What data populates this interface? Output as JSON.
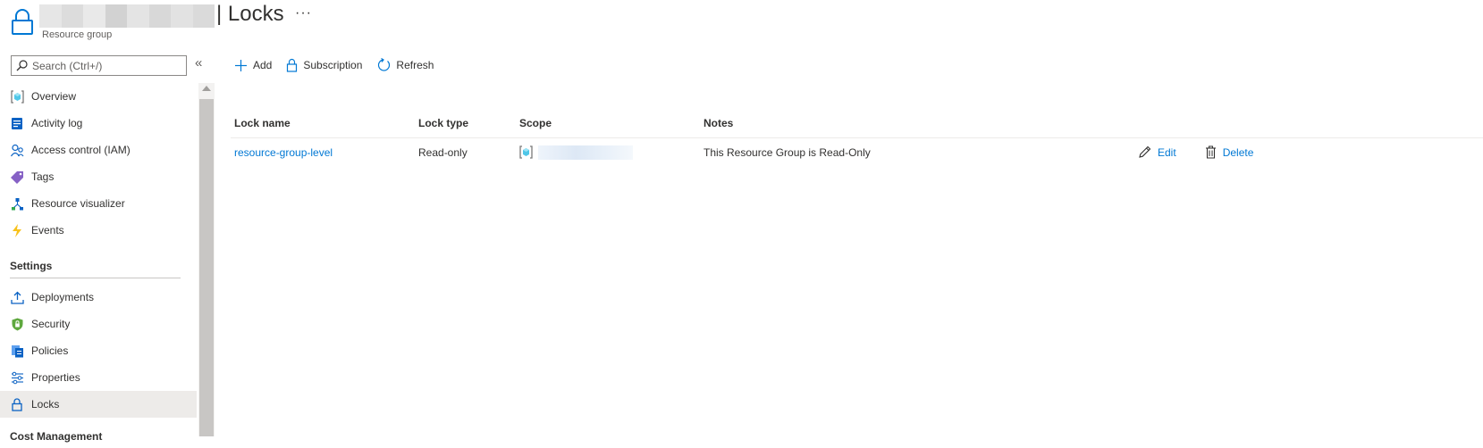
{
  "header": {
    "title": "| Locks",
    "subtitle": "Resource group",
    "more": "···"
  },
  "sidebar": {
    "search_placeholder": "Search (Ctrl+/)",
    "collapse": "«",
    "items": [
      {
        "label": "Overview",
        "icon": "resource-group-icon"
      },
      {
        "label": "Activity log",
        "icon": "activity-log-icon"
      },
      {
        "label": "Access control (IAM)",
        "icon": "people-icon"
      },
      {
        "label": "Tags",
        "icon": "tag-icon"
      },
      {
        "label": "Resource visualizer",
        "icon": "visualizer-icon"
      },
      {
        "label": "Events",
        "icon": "lightning-icon"
      }
    ],
    "settings_header": "Settings",
    "settings_items": [
      {
        "label": "Deployments",
        "icon": "upload-icon"
      },
      {
        "label": "Security",
        "icon": "shield-icon"
      },
      {
        "label": "Policies",
        "icon": "policy-icon"
      },
      {
        "label": "Properties",
        "icon": "sliders-icon"
      },
      {
        "label": "Locks",
        "icon": "lock-icon",
        "active": true
      }
    ],
    "cost_header": "Cost Management"
  },
  "toolbar": {
    "add": "Add",
    "subscription": "Subscription",
    "refresh": "Refresh"
  },
  "table": {
    "columns": [
      "Lock name",
      "Lock type",
      "Scope",
      "Notes"
    ],
    "rows": [
      {
        "name": "resource-group-level",
        "type": "Read-only",
        "notes": "This Resource Group is Read-Only",
        "edit": "Edit",
        "delete": "Delete"
      }
    ]
  },
  "colors": {
    "accent": "#0078d4",
    "active_bg": "#edebe9",
    "text": "#323130"
  }
}
